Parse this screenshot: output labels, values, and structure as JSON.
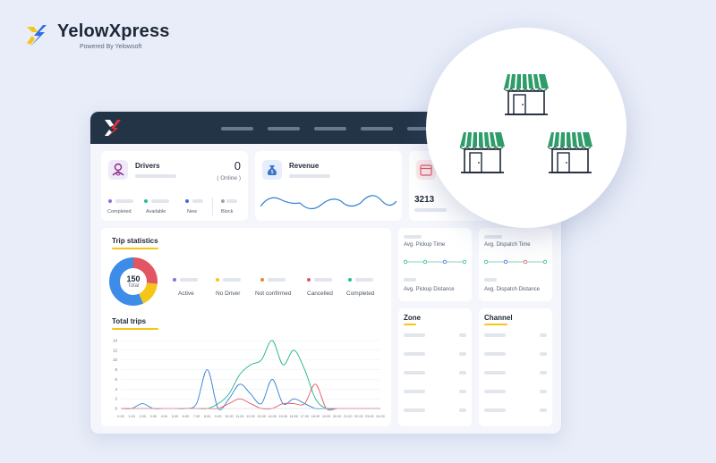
{
  "brand": {
    "name": "YelowXpress",
    "subtitle": "Powered By Yelowsoft"
  },
  "drivers": {
    "title": "Drivers",
    "count": "0",
    "status": "( Online )",
    "legend": [
      {
        "label": "Completed",
        "color": "#8b6fd6"
      },
      {
        "label": "Available",
        "color": "#22c08a"
      },
      {
        "label": "New",
        "color": "#3c6fd6"
      },
      {
        "label": "Block",
        "color": "#9aa3b2"
      }
    ]
  },
  "revenue": {
    "title": "Revenue"
  },
  "third_card": {
    "value": "3213"
  },
  "trip_stats": {
    "title": "Trip statistics",
    "total_value": "150",
    "total_label": "Total",
    "legend": [
      {
        "label": "Active",
        "color": "#8b6fd6"
      },
      {
        "label": "No Driver",
        "color": "#f5c518"
      },
      {
        "label": "Not confirmed",
        "color": "#f2802c"
      },
      {
        "label": "Cancelled",
        "color": "#e25563"
      },
      {
        "label": "Completed",
        "color": "#22c08a"
      }
    ]
  },
  "metrics": {
    "pickup_time": "Avg. Pickup Time",
    "pickup_distance": "Avg. Pickup Distance",
    "dispatch_time": "Avg. Dispatch Time",
    "dispatch_distance": "Avg. Dispatch Distance"
  },
  "zone": {
    "title": "Zone"
  },
  "channel": {
    "title": "Channel"
  },
  "total_trips": {
    "title": "Total trips"
  },
  "colors": {
    "accent": "#f5c518",
    "dark_header": "#233447",
    "line_green": "#22b38a",
    "line_blue": "#2f7fd1",
    "line_red": "#e25563",
    "store_green": "#2e9d6a"
  },
  "icons": [
    "x-logo-icon",
    "driver-icon",
    "money-bag-icon",
    "calendar-icon",
    "store-icon"
  ],
  "chart_data": {
    "type": "line",
    "x": [
      "0.00",
      "1.00",
      "2.00",
      "3.00",
      "4.00",
      "5.00",
      "6.00",
      "7.00",
      "8.00",
      "9.00",
      "10.00",
      "11.00",
      "12.00",
      "13.00",
      "14.00",
      "15.00",
      "16.00",
      "17.00",
      "18.00",
      "19.00",
      "20.00",
      "21.00",
      "22.00",
      "23.00",
      "24.00"
    ],
    "series": [
      {
        "color": "#22b38a",
        "values": [
          0,
          0,
          0,
          0,
          0,
          0,
          0,
          0,
          0,
          1,
          3,
          7,
          9,
          10,
          14,
          9,
          12,
          8,
          2,
          0,
          0,
          0,
          0,
          0,
          0
        ]
      },
      {
        "color": "#2f7fd1",
        "values": [
          0,
          0,
          1,
          0,
          0,
          0,
          0,
          1,
          8,
          0,
          2,
          5,
          3,
          1,
          6,
          1,
          2,
          1,
          0,
          0,
          0,
          0,
          0,
          0,
          0
        ]
      },
      {
        "color": "#e25563",
        "values": [
          0,
          0,
          0,
          0,
          0,
          0,
          0,
          0,
          0,
          0,
          1,
          2,
          1,
          0,
          0,
          1,
          1,
          1,
          5,
          0,
          0,
          0,
          0,
          0,
          0
        ]
      }
    ],
    "y_ticks": [
      "0",
      "2",
      "4",
      "6",
      "8",
      "10",
      "12",
      "14"
    ],
    "ylim": [
      0,
      14
    ],
    "grid": true
  }
}
